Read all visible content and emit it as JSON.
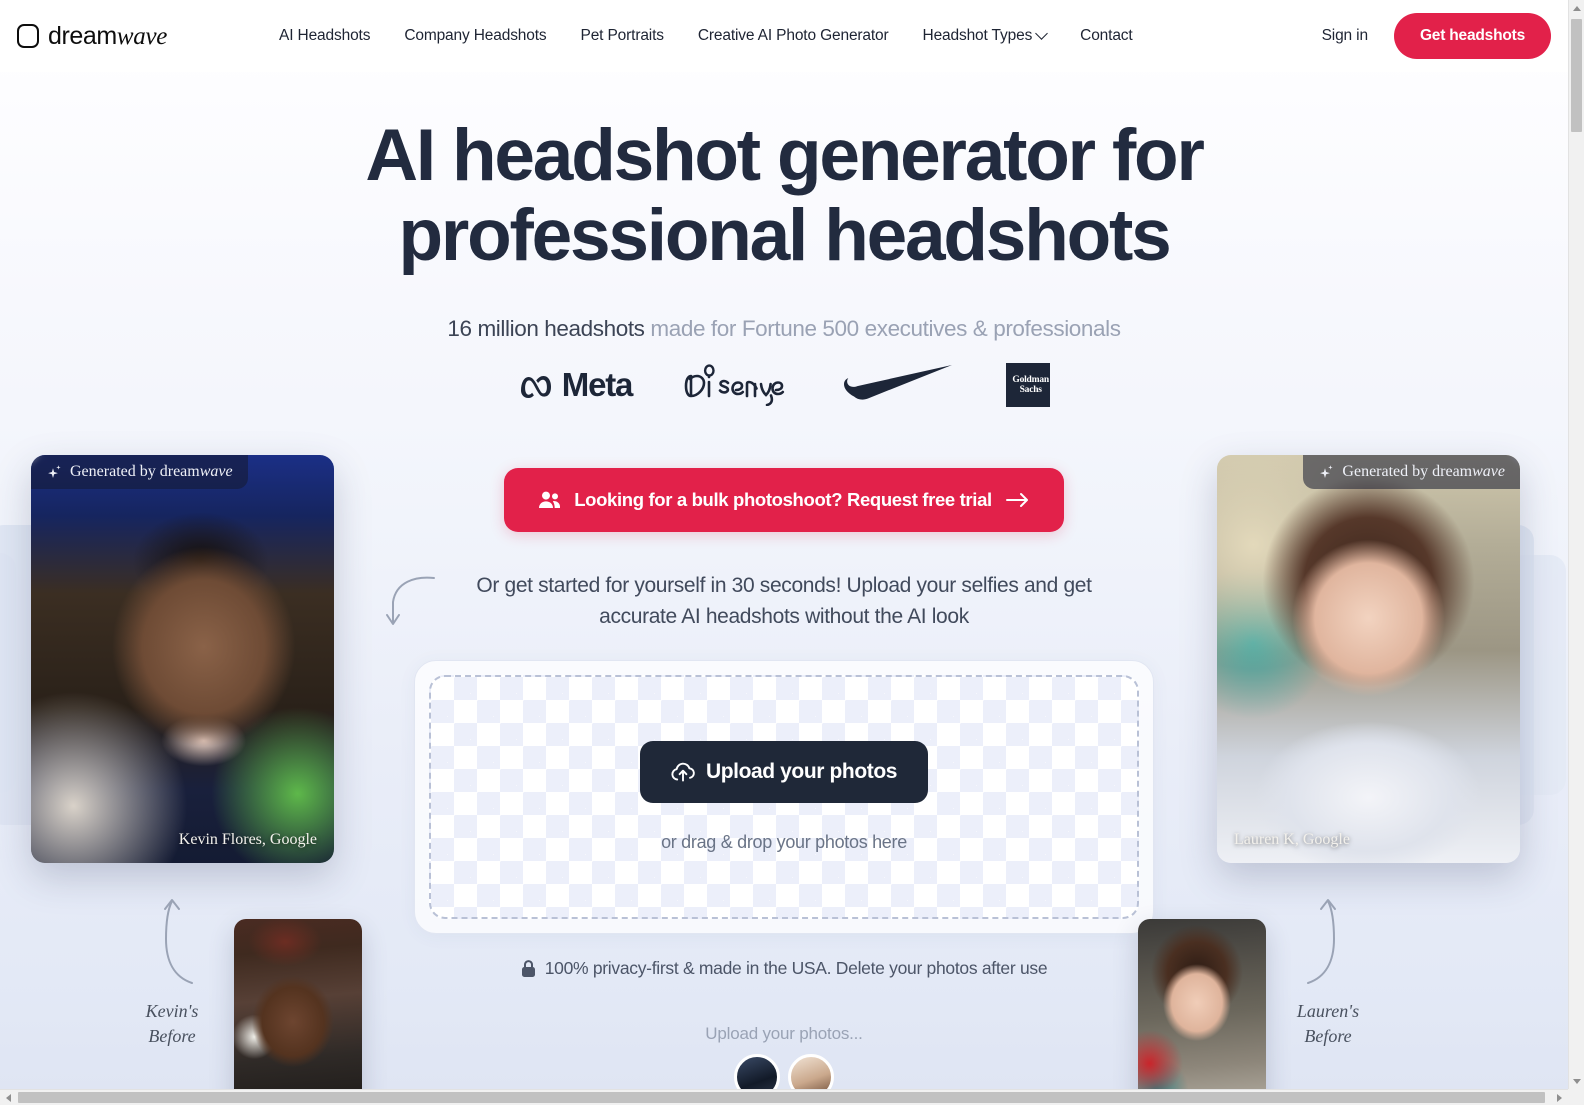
{
  "brand": {
    "logo_prefix": "dream",
    "logo_suffix": "wave",
    "accent_red": "#e2214a",
    "ink": "#222b3f"
  },
  "nav": {
    "links": [
      {
        "label": "AI Headshots",
        "has_chevron": false
      },
      {
        "label": "Company Headshots",
        "has_chevron": false
      },
      {
        "label": "Pet Portraits",
        "has_chevron": false
      },
      {
        "label": "Creative AI Photo Generator",
        "has_chevron": false
      },
      {
        "label": "Headshot Types",
        "has_chevron": true
      },
      {
        "label": "Contact",
        "has_chevron": false
      }
    ],
    "sign_in": "Sign in",
    "cta": "Get headshots"
  },
  "hero": {
    "headline": "AI headshot generator for professional headshots",
    "subline_strong": "16 million headshots",
    "subline_rest": " made for Fortune 500 executives & professionals",
    "brands": [
      {
        "name": "Meta",
        "label": "Meta"
      },
      {
        "name": "Disney",
        "label": "Disney"
      },
      {
        "name": "Nike",
        "label": ""
      },
      {
        "name": "Goldman Sachs",
        "label_line1": "Goldman",
        "label_line2": "Sachs"
      }
    ],
    "bulk_cta": "Looking for a bulk photoshoot? Request free trial",
    "instruction": "Or get started for yourself in 30 seconds! Upload your selfies and get accurate AI headshots without the AI look"
  },
  "dropzone": {
    "upload_button": "Upload your photos",
    "drag_hint": "or drag & drop your photos here",
    "privacy_note": "100% privacy-first & made in the USA. Delete your photos after use",
    "more_hint": "Upload your photos..."
  },
  "showcase": {
    "generated_badge_prefix": "Generated by dream",
    "generated_badge_suffix": "wave",
    "left": {
      "caption": "Kevin Flores, Google",
      "before_label_line1": "Kevin's",
      "before_label_line2": "Before"
    },
    "right": {
      "caption": "Lauren K, Google",
      "before_label_line1": "Lauren's",
      "before_label_line2": "Before"
    }
  }
}
